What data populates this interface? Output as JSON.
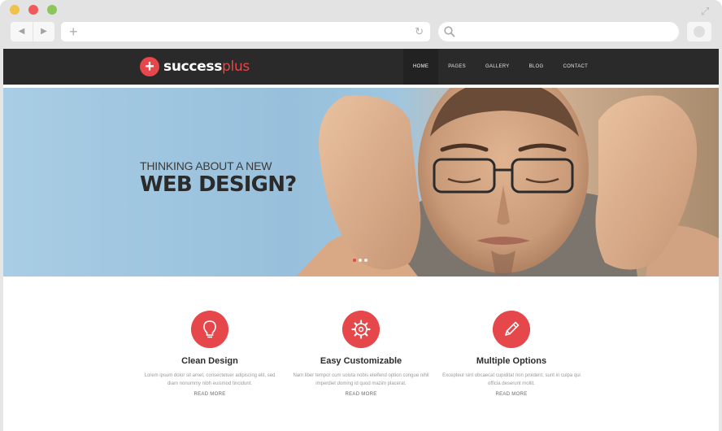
{
  "browser": {
    "window_controls": [
      "close",
      "minimize",
      "zoom"
    ],
    "toolbar": {
      "back_icon": "◀",
      "forward_icon": "▶",
      "new_tab_icon": "+",
      "reload_icon": "↻",
      "search_icon": "search-icon"
    },
    "colors": {
      "dot_yellow": "#f0c24a",
      "dot_red": "#f05a5a",
      "dot_green": "#8cc65a"
    }
  },
  "site": {
    "logo": {
      "brand": "success",
      "accent": "plus",
      "mark": "+"
    },
    "nav": [
      {
        "label": "HOME",
        "active": true
      },
      {
        "label": "PAGES",
        "active": false
      },
      {
        "label": "GALLERY",
        "active": false
      },
      {
        "label": "BLOG",
        "active": false
      },
      {
        "label": "CONTACT",
        "active": false
      }
    ],
    "hero": {
      "small": "THINKING ABOUT A NEW",
      "headline": "WEB DESIGN?",
      "slider_dots": 3,
      "active_dot": 0
    },
    "features": [
      {
        "icon": "lightbulb-icon",
        "title": "Clean Design",
        "text": "Lorem ipsum dolor sit amet, consectetuer adipiscing elit, sed diam nonummy nibh euismod tincidunt.",
        "link": "READ MORE"
      },
      {
        "icon": "gear-icon",
        "title": "Easy Customizable",
        "text": "Nam liber tempor cum soluta nobis eleifend option congue nihil imperdiet doming id quod mazim placerat.",
        "link": "READ MORE"
      },
      {
        "icon": "pencil-icon",
        "title": "Multiple Options",
        "text": "Excepteur sint obcaecat cupiditat non proident, sunt in culpa qui officia deserunt mollit.",
        "link": "READ MORE"
      }
    ],
    "colors": {
      "accent": "#e6474a",
      "nav_bg": "#2a2a2a"
    }
  }
}
